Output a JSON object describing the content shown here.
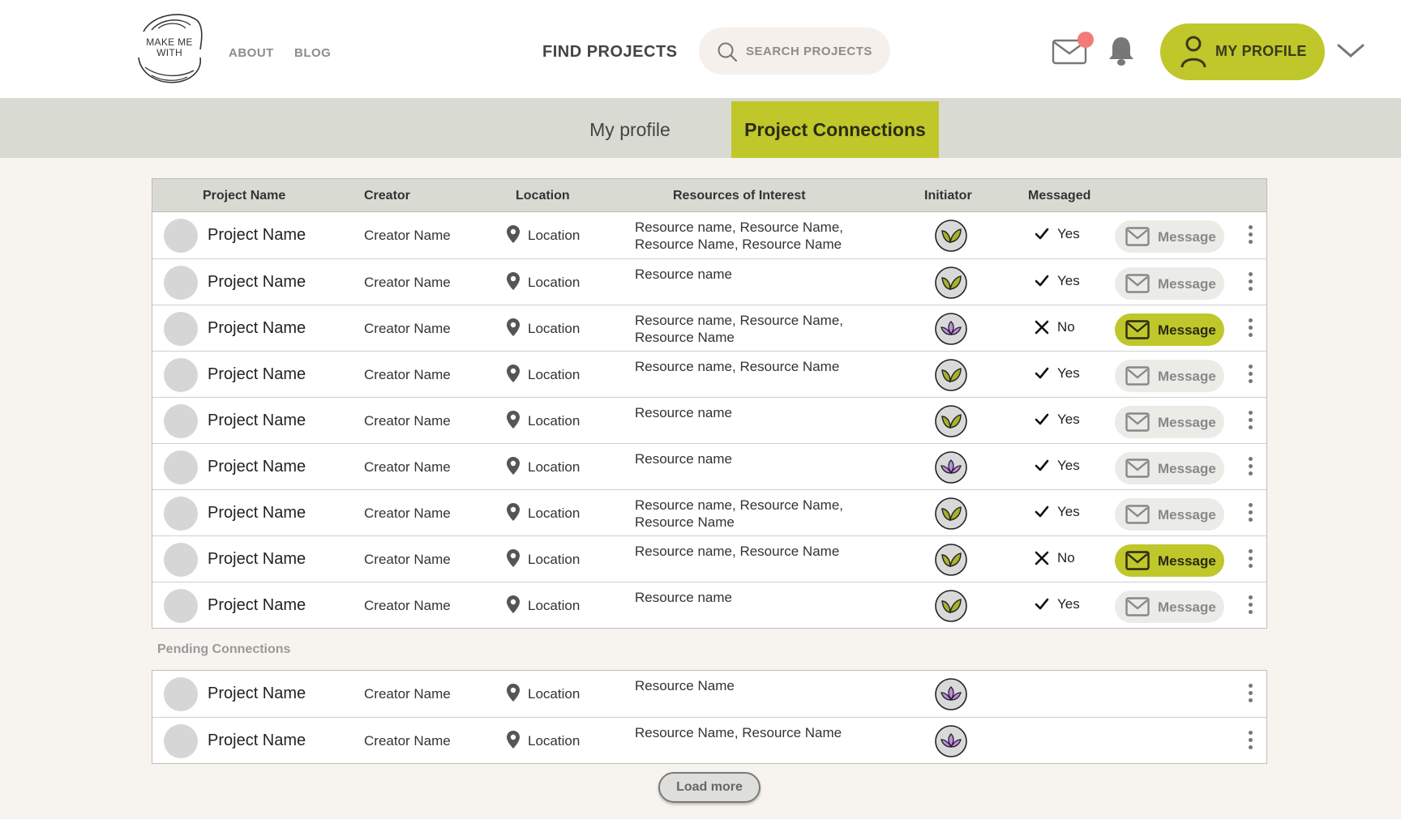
{
  "header": {
    "logo_text": [
      "MAKE ME",
      "WITH"
    ],
    "nav": {
      "about": "ABOUT",
      "blog": "BLOG",
      "find_projects": "FIND PROJECTS"
    },
    "search_placeholder": "SEARCH PROJECTS",
    "profile_label": "MY PROFILE",
    "mail_notification": true
  },
  "tabs": {
    "profile": "My profile",
    "connections": "Project Connections",
    "active": "connections"
  },
  "table": {
    "headers": {
      "project_name": "Project Name",
      "creator": "Creator",
      "location": "Location",
      "resources": "Resources of Interest",
      "initiator": "Initiator",
      "messaged": "Messaged"
    },
    "rows": [
      {
        "project": "Project Name",
        "creator": "Creator Name",
        "location": "Location",
        "resources": [
          "Resource name, Resource Name,",
          "Resource Name, Resource Name"
        ],
        "initiator": "leaf",
        "messaged": "Yes",
        "messaged_icon": "check",
        "button": "Message",
        "button_active": false
      },
      {
        "project": "Project Name",
        "creator": "Creator Name",
        "location": "Location",
        "resources": [
          "Resource name"
        ],
        "initiator": "leaf",
        "messaged": "Yes",
        "messaged_icon": "check",
        "button": "Message",
        "button_active": false
      },
      {
        "project": "Project Name",
        "creator": "Creator Name",
        "location": "Location",
        "resources": [
          "Resource name, Resource Name,",
          "Resource Name"
        ],
        "initiator": "lotus",
        "messaged": "No",
        "messaged_icon": "cross",
        "button": "Message",
        "button_active": true
      },
      {
        "project": "Project Name",
        "creator": "Creator Name",
        "location": "Location",
        "resources": [
          "Resource name, Resource Name"
        ],
        "initiator": "leaf",
        "messaged": "Yes",
        "messaged_icon": "check",
        "button": "Message",
        "button_active": false
      },
      {
        "project": "Project Name",
        "creator": "Creator Name",
        "location": "Location",
        "resources": [
          "Resource name"
        ],
        "initiator": "leaf",
        "messaged": "Yes",
        "messaged_icon": "check",
        "button": "Message",
        "button_active": false
      },
      {
        "project": "Project Name",
        "creator": "Creator Name",
        "location": "Location",
        "resources": [
          "Resource name"
        ],
        "initiator": "lotus",
        "messaged": "Yes",
        "messaged_icon": "check",
        "button": "Message",
        "button_active": false
      },
      {
        "project": "Project Name",
        "creator": "Creator Name",
        "location": "Location",
        "resources": [
          "Resource name, Resource Name,",
          "Resource Name"
        ],
        "initiator": "leaf",
        "messaged": "Yes",
        "messaged_icon": "check",
        "button": "Message",
        "button_active": false
      },
      {
        "project": "Project Name",
        "creator": "Creator Name",
        "location": "Location",
        "resources": [
          "Resource name, Resource Name"
        ],
        "initiator": "leaf",
        "messaged": "No",
        "messaged_icon": "cross",
        "button": "Message",
        "button_active": true
      },
      {
        "project": "Project Name",
        "creator": "Creator Name",
        "location": "Location",
        "resources": [
          "Resource name"
        ],
        "initiator": "leaf",
        "messaged": "Yes",
        "messaged_icon": "check",
        "button": "Message",
        "button_active": false
      }
    ]
  },
  "pending": {
    "label": "Pending Connections",
    "rows": [
      {
        "project": "Project Name",
        "creator": "Creator Name",
        "location": "Location",
        "resources": [
          "Resource Name"
        ],
        "initiator": "lotus"
      },
      {
        "project": "Project Name",
        "creator": "Creator Name",
        "location": "Location",
        "resources": [
          "Resource Name, Resource Name"
        ],
        "initiator": "lotus"
      }
    ]
  },
  "load_more": "Load more",
  "colors": {
    "accent": "#bfc72b",
    "leaf": "#a7b22a",
    "lotus": "#c389e6",
    "mail_dot": "#f47a7a"
  }
}
